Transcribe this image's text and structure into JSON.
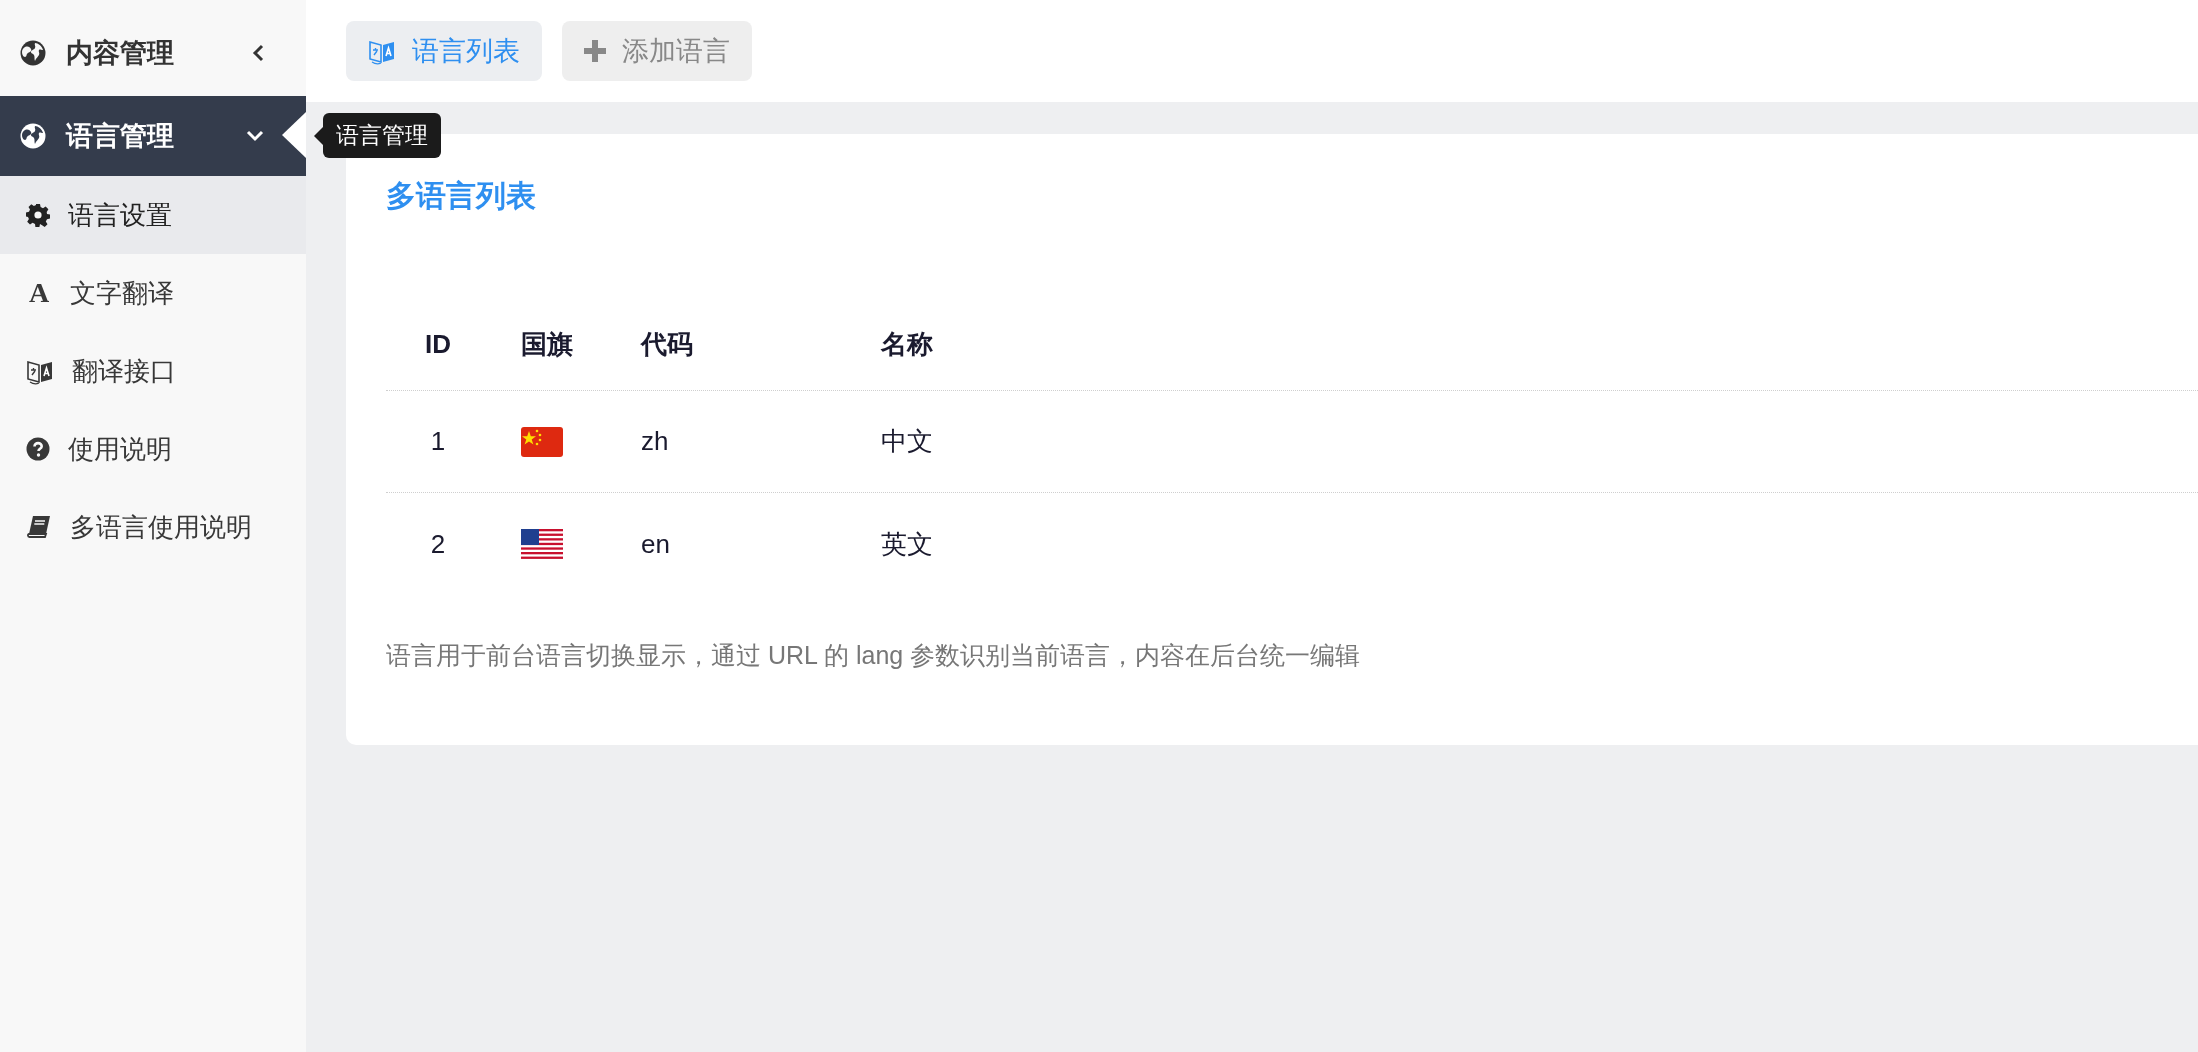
{
  "sidebar": {
    "items": [
      {
        "label": "内容管理",
        "kind": "globe",
        "selected": false,
        "expanded": false
      },
      {
        "label": "语言管理",
        "kind": "globe",
        "selected": true,
        "expanded": true,
        "children": [
          {
            "label": "语言设置",
            "kind": "gear",
            "selected": true
          },
          {
            "label": "文字翻译",
            "kind": "letter",
            "glyph": "A",
            "selected": false
          },
          {
            "label": "翻译接口",
            "kind": "translate",
            "selected": false
          },
          {
            "label": "使用说明",
            "kind": "question",
            "selected": false
          },
          {
            "label": "多语言使用说明",
            "kind": "book",
            "selected": false
          }
        ]
      }
    ]
  },
  "tooltip": {
    "text": "语言管理"
  },
  "toolbar": {
    "tabs": [
      {
        "label": "语言列表",
        "kind": "translate",
        "selected": true
      },
      {
        "label": "添加语言",
        "kind": "plus",
        "selected": false
      }
    ]
  },
  "card": {
    "title": "多语言列表",
    "table": {
      "columns": [
        "ID",
        "国旗",
        "代码",
        "名称"
      ],
      "rows": [
        {
          "id": "1",
          "kind": "cn",
          "code": "zh",
          "name": "中文"
        },
        {
          "id": "2",
          "kind": "us",
          "code": "en",
          "name": "英文"
        }
      ]
    },
    "note": "语言用于前台语言切换显示，通过 URL 的 lang 参数识别当前语言，内容在后台统一编辑"
  }
}
